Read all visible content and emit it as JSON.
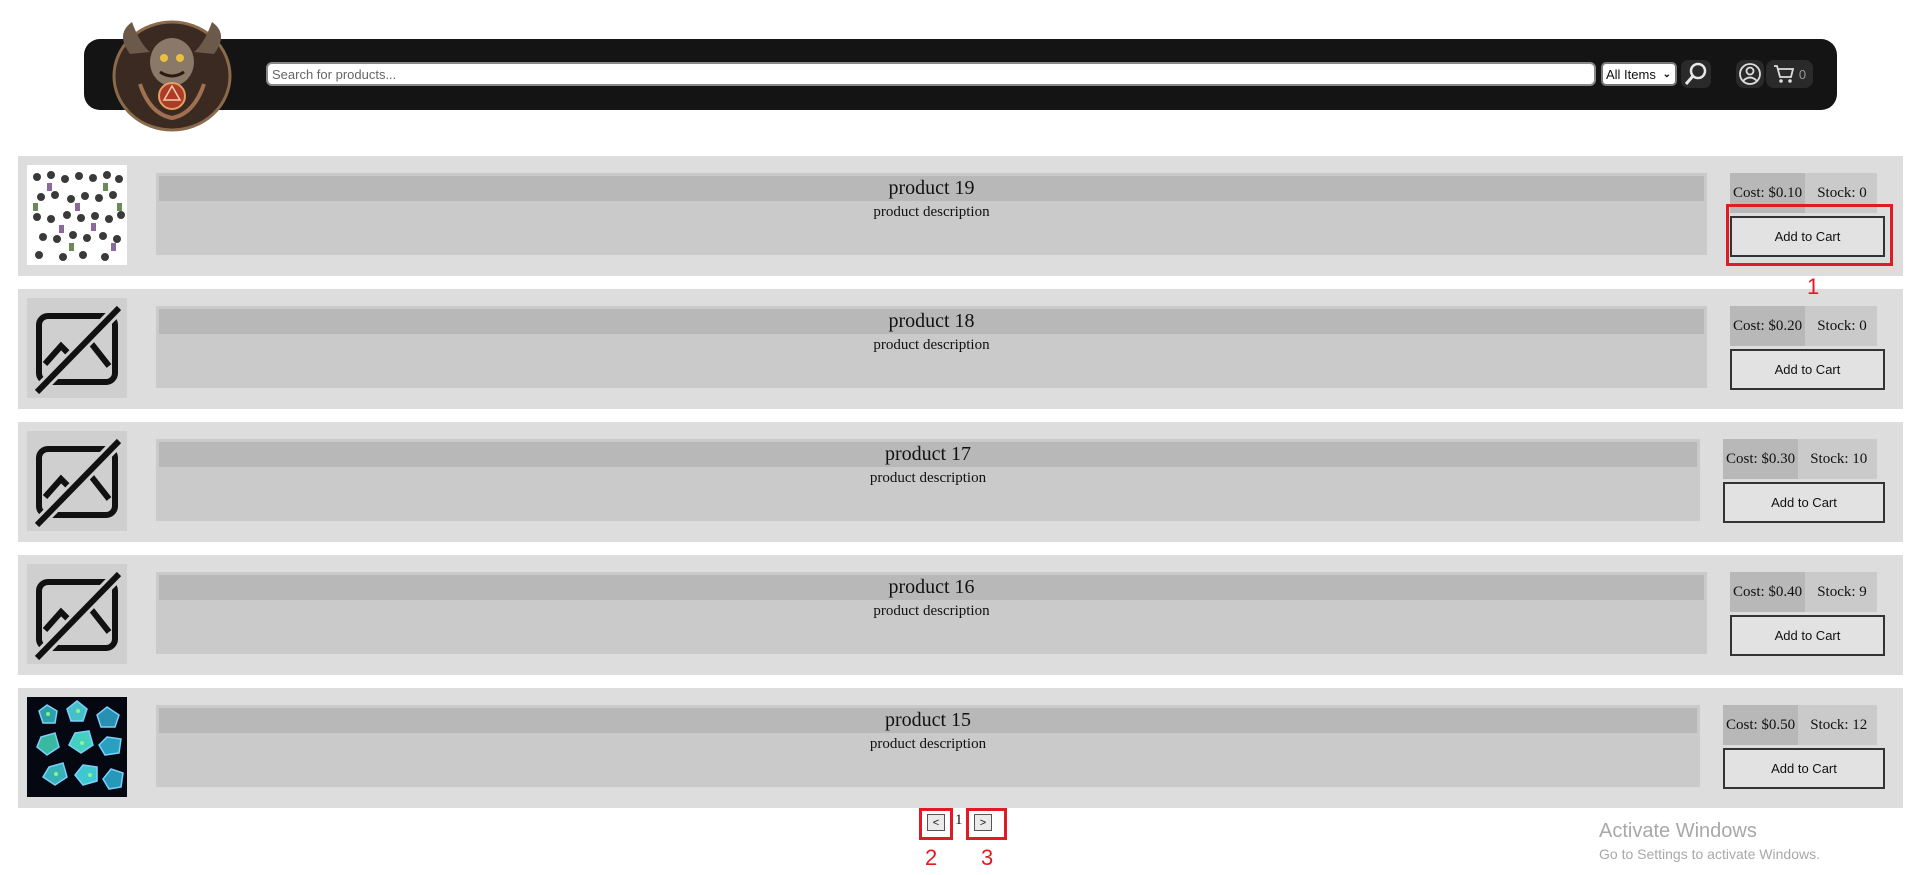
{
  "header": {
    "search_placeholder": "Search for products...",
    "category_selected": "All Items",
    "cart_count": "0"
  },
  "products": [
    {
      "name": "product 19",
      "description": "product description",
      "cost": "Cost: $0.10",
      "stock": "Stock: 0",
      "add_label": "Add to Cart",
      "image": "miniatures"
    },
    {
      "name": "product 18",
      "description": "product description",
      "cost": "Cost: $0.20",
      "stock": "Stock: 0",
      "add_label": "Add to Cart",
      "image": "no-image"
    },
    {
      "name": "product 17",
      "description": "product description",
      "cost": "Cost: $0.30",
      "stock": "Stock: 10",
      "add_label": "Add to Cart",
      "image": "no-image"
    },
    {
      "name": "product 16",
      "description": "product description",
      "cost": "Cost: $0.40",
      "stock": "Stock: 9",
      "add_label": "Add to Cart",
      "image": "no-image"
    },
    {
      "name": "product 15",
      "description": "product description",
      "cost": "Cost: $0.50",
      "stock": "Stock: 12",
      "add_label": "Add to Cart",
      "image": "dice"
    }
  ],
  "pagination": {
    "prev": "<",
    "page": "1",
    "next": ">"
  },
  "annotations": [
    "1",
    "2",
    "3"
  ],
  "watermark": {
    "title": "Activate Windows",
    "subtitle": "Go to Settings to activate Windows."
  },
  "colors": {
    "header_bg": "#141414",
    "row_bg": "#dddddd",
    "annotation": "#e01b24"
  }
}
